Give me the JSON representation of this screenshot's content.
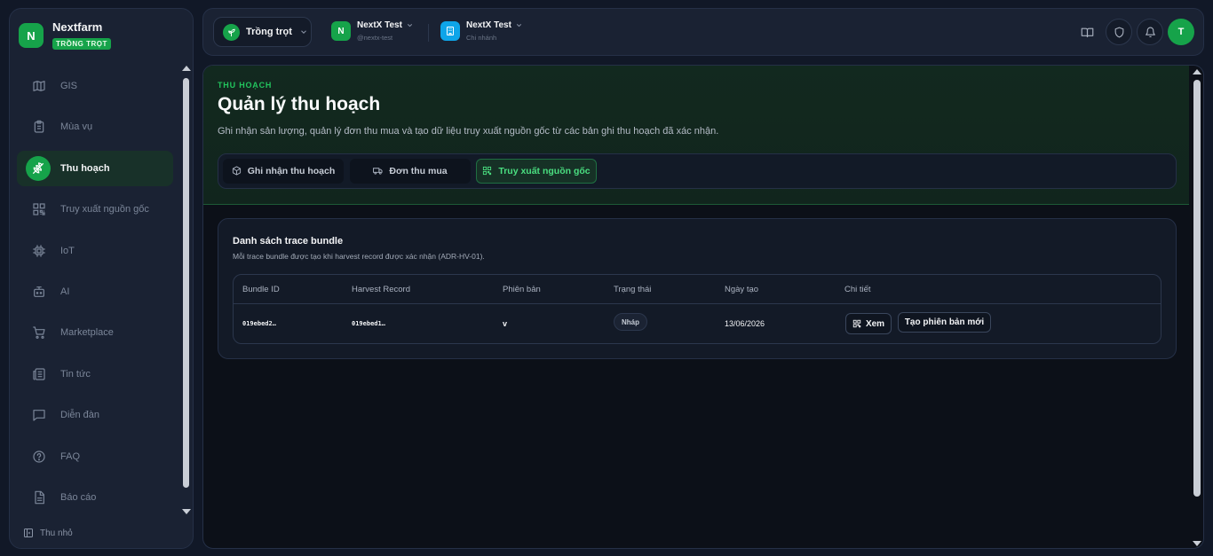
{
  "brand": {
    "logo_letter": "N",
    "name": "Nextfarm",
    "badge": "TRỒNG TRỌT"
  },
  "sidebar": {
    "items": [
      {
        "label": "GIS",
        "icon": "map-icon",
        "active": false
      },
      {
        "label": "Mùa vụ",
        "icon": "clipboard-icon",
        "active": false
      },
      {
        "label": "Thu hoạch",
        "icon": "wheat-icon",
        "active": true
      },
      {
        "label": "Truy xuất nguồn gốc",
        "icon": "qr-code-icon",
        "active": false
      },
      {
        "label": "IoT",
        "icon": "chip-icon",
        "active": false
      },
      {
        "label": "AI",
        "icon": "bot-icon",
        "active": false
      },
      {
        "label": "Marketplace",
        "icon": "cart-icon",
        "active": false
      },
      {
        "label": "Tin tức",
        "icon": "newspaper-icon",
        "active": false
      },
      {
        "label": "Diễn đàn",
        "icon": "message-icon",
        "active": false
      },
      {
        "label": "FAQ",
        "icon": "help-circle-icon",
        "active": false
      },
      {
        "label": "Báo cáo",
        "icon": "file-text-icon",
        "active": false
      }
    ],
    "collapse_label": "Thu nhỏ"
  },
  "topbar": {
    "crop_selector": "Trồng trọt",
    "org1": {
      "letter": "N",
      "name": "NextX Test",
      "sub": "@nextx-test"
    },
    "org2": {
      "name": "NextX Test",
      "sub": "Chi nhánh"
    },
    "avatar_letter": "T"
  },
  "page": {
    "eyebrow": "THU HOẠCH",
    "title": "Quản lý thu hoạch",
    "description": "Ghi nhận sản lượng, quản lý đơn thu mua và tạo dữ liệu truy xuất nguồn gốc từ các bản ghi thu hoạch đã xác nhận.",
    "tabs": [
      {
        "label": "Ghi nhận thu hoạch",
        "icon": "box-icon",
        "active": false
      },
      {
        "label": "Đơn thu mua",
        "icon": "truck-icon",
        "active": false
      },
      {
        "label": "Truy xuất nguồn gốc",
        "icon": "qr-code-icon",
        "active": true
      }
    ]
  },
  "card": {
    "title": "Danh sách trace bundle",
    "subtitle": "Mỗi trace bundle được tạo khi harvest record được xác nhận (ADR-HV-01).",
    "columns": [
      "Bundle ID",
      "Harvest Record",
      "Phiên bản",
      "Trạng thái",
      "Ngày tạo",
      "Chi tiết"
    ],
    "rows": [
      {
        "bundle_id": "019ebed2…",
        "harvest_record": "019ebed1…",
        "version": "v",
        "status": "Nháp",
        "created": "13/06/2026",
        "view_label": "Xem",
        "new_version_label": "Tạo phiên bản mới"
      }
    ]
  },
  "colors": {
    "accent": "#16a34a",
    "accent_text": "#22c55e",
    "bg": "#111827",
    "panel": "#1a2233"
  }
}
